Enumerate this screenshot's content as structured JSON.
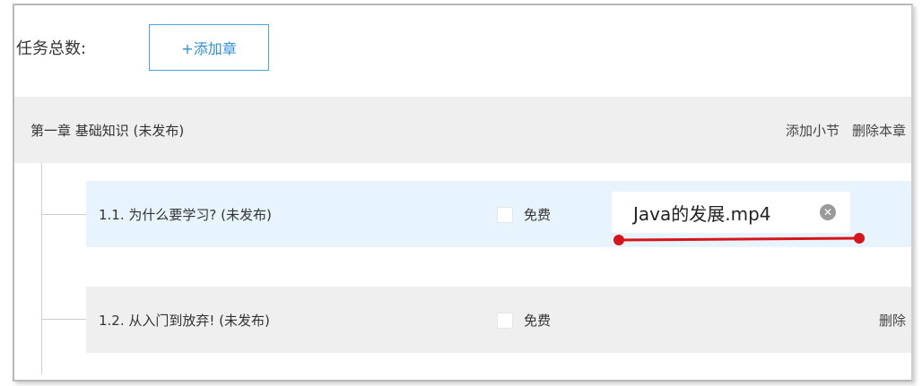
{
  "header": {
    "task_total_label": "任务总数:",
    "add_chapter_button": "+添加章"
  },
  "chapter": {
    "title": "第一章 基础知识 (未发布)",
    "add_section": "添加小节",
    "delete_chapter": "删除本章"
  },
  "sections": [
    {
      "title": "1.1. 为什么要学习? (未发布)",
      "free_label": "免费",
      "free_checked": false,
      "file_name": "Java的发展.mp4",
      "remove_icon": "x-circle-icon"
    },
    {
      "title": "1.2. 从入门到放弃! (未发布)",
      "free_label": "免费",
      "free_checked": false,
      "delete_label": "删除"
    }
  ],
  "colors": {
    "accent_blue": "#2f8fd6",
    "active_row_bg": "#e8f4fd",
    "row_bg": "#efefef",
    "annotation_red": "#d8141b"
  }
}
